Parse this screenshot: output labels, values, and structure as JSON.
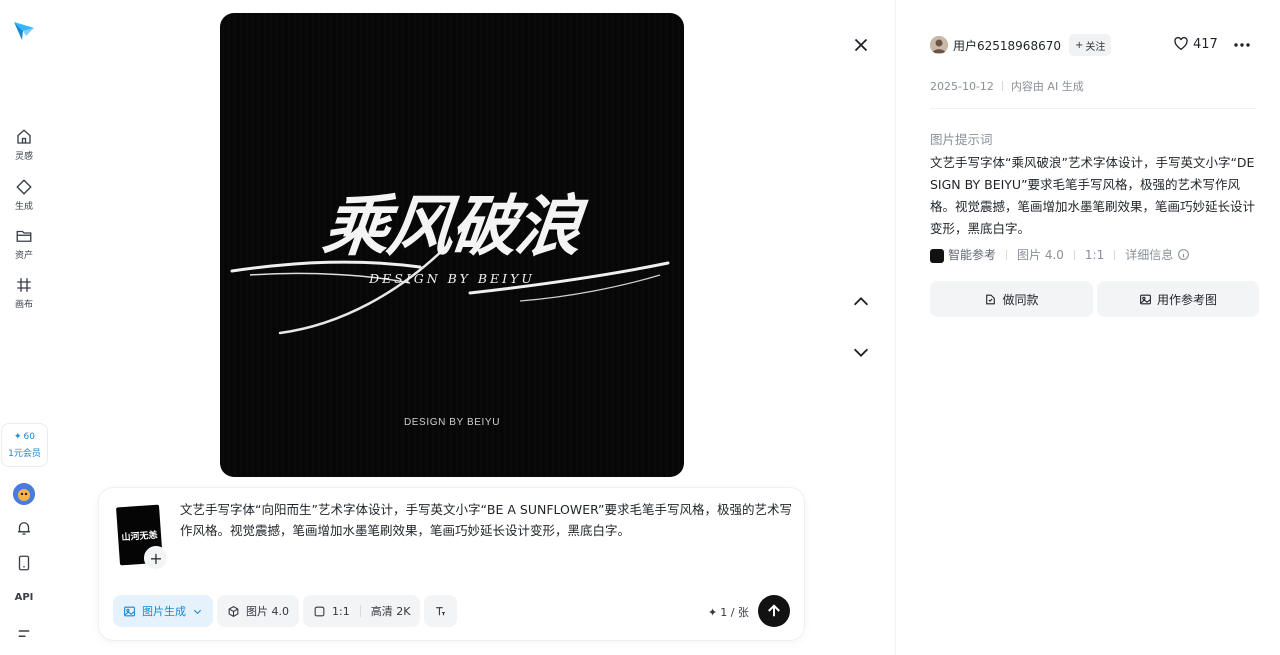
{
  "nav": {
    "items": [
      {
        "label": "灵感",
        "icon": "home-icon"
      },
      {
        "label": "生成",
        "icon": "diamond-icon"
      },
      {
        "label": "资产",
        "icon": "folder-icon"
      },
      {
        "label": "画布",
        "icon": "canvas-icon"
      }
    ],
    "credits_count": "60",
    "credits_offer": "1元会员",
    "api_label": "API"
  },
  "artwork": {
    "title_text": "乘风破浪",
    "subtitle_text": "DESIGN  BY BEIYU",
    "footer_text": "DESIGN BY BEIYU"
  },
  "composer": {
    "ref_thumb_text": "山河无恙",
    "prompt": "文艺手写字体“向阳而生”艺术字体设计，手写英文小字“BE A SUNFLOWER”要求毛笔手写风格，极强的艺术写作风格。视觉震撼，笔画增加水墨笔刷效果，笔画巧妙延长设计变形，黑底白字。",
    "mode_label": "图片生成",
    "model_label": "图片 4.0",
    "ratio_label": "1:1",
    "quality_label": "高清 2K",
    "quota_label": "1 / 张"
  },
  "detail": {
    "author": "用户62518968670",
    "follow_label": "关注",
    "likes": "417",
    "date": "2025-10-12",
    "ai_note": "内容由 AI 生成",
    "prompt_title": "图片提示词",
    "prompt_body": "文艺手写字体“乘风破浪”艺术字体设计，手写英文小字“DESIGN BY BEIYU”要求毛笔手写风格，极强的艺术写作风格。视觉震撼，笔画增加水墨笔刷效果，笔画巧妙延长设计变形，黑底白字。",
    "ref_type": "智能参考",
    "model": "图片 4.0",
    "ratio": "1:1",
    "detail_label": "详细信息",
    "btn_same": "做同款",
    "btn_reference": "用作参考图"
  },
  "colors": {
    "accent": "#1a88d4",
    "send_button": "#121212",
    "chip_bg": "#f3f4f6"
  }
}
